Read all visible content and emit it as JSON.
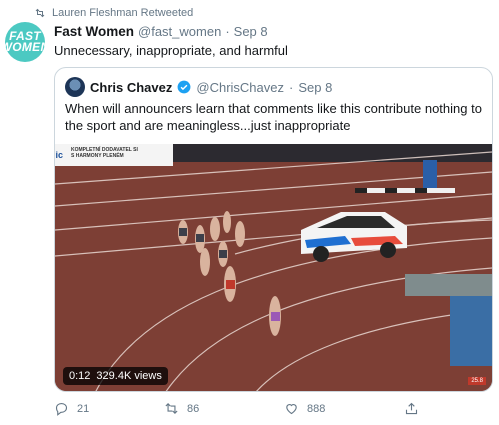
{
  "retweet": {
    "label": "Lauren Fleshman Retweeted"
  },
  "tweet": {
    "avatar_text_1": "FAST",
    "avatar_text_2": "WOMEN",
    "name": "Fast Women",
    "handle": "@fast_women",
    "separator": "·",
    "date": "Sep 8",
    "text": "Unnecessary, inappropriate, and harmful"
  },
  "quoted": {
    "name": "Chris Chavez",
    "handle": "@ChrisChavez",
    "separator": "·",
    "date": "Sep 8",
    "text": "When will announcers learn that comments like this contribute nothing to the sport and are meaningless...just inappropriate",
    "video": {
      "time": "0:12",
      "views": "329.4K views",
      "banner_line1": "KOMPLETNÍ DODAVATEL SI",
      "banner_line2": "S HARMONY PLENÉM",
      "banner_prefix": "lic",
      "score": "25.8"
    }
  },
  "actions": {
    "replies": "21",
    "retweets": "86",
    "likes": "888"
  },
  "colors": {
    "avatar_bg": "#4cc9c2",
    "verified": "#1da1f2",
    "meta_gray": "#657786",
    "track": "#7a3b33"
  }
}
